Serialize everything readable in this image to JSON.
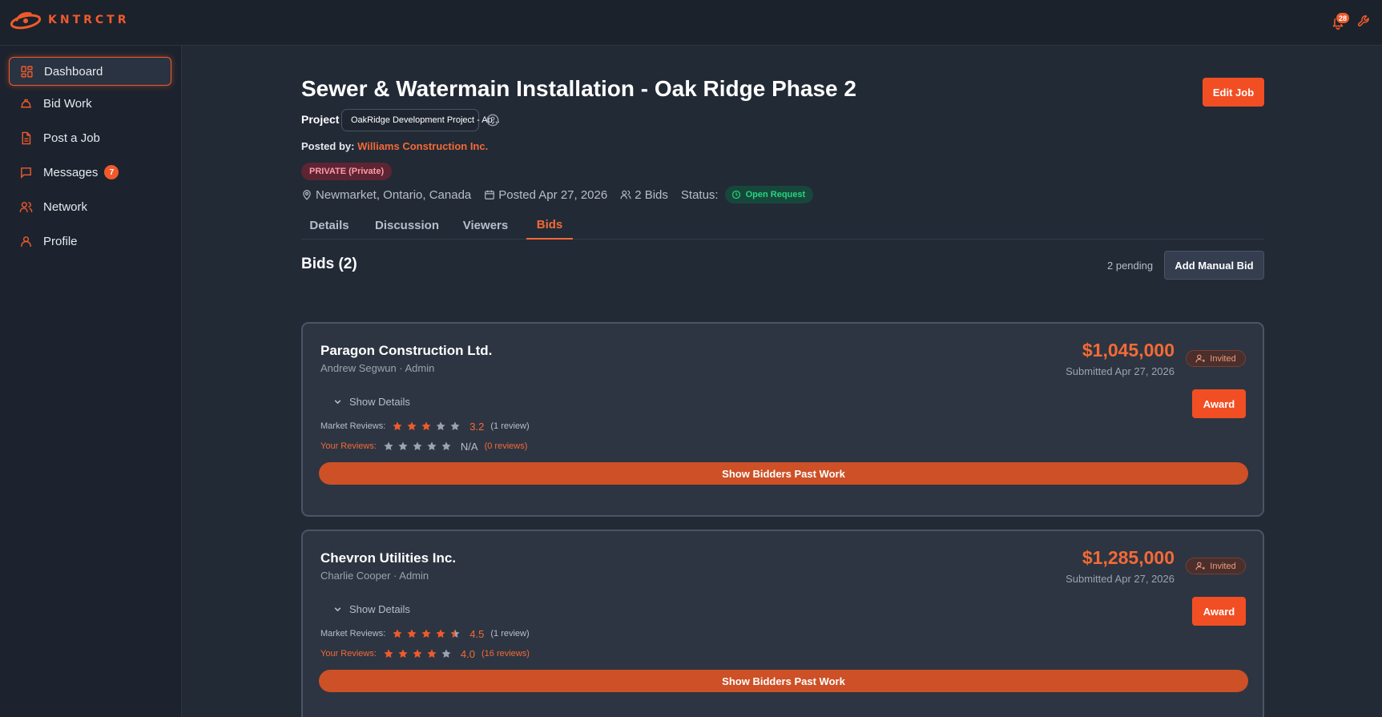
{
  "app": {
    "logo_text": "KNTRCTR",
    "notification_count": "28",
    "accent": "#f05a2b"
  },
  "sidebar": {
    "items": [
      {
        "label": "Dashboard",
        "icon": "dashboard-icon"
      },
      {
        "label": "Bid Work",
        "icon": "hardhat-icon"
      },
      {
        "label": "Post a Job",
        "icon": "document-icon"
      },
      {
        "label": "Messages",
        "icon": "message-icon",
        "badge": "7"
      },
      {
        "label": "Network",
        "icon": "users-icon"
      },
      {
        "label": "Profile",
        "icon": "user-icon"
      }
    ]
  },
  "job": {
    "title": "Sewer & Watermain Installation - Oak Ridge Phase 2",
    "edit_label": "Edit Job",
    "project_label": "Project",
    "project_value": "OakRidge Development Project - Ap...",
    "posted_by_label": "Posted by:",
    "posted_by_company": "Williams Construction Inc.",
    "privacy_badge": "PRIVATE (Private)",
    "location": "Newmarket, Ontario, Canada",
    "posted_date": "Posted Apr 27, 2026",
    "bid_count": "2 Bids",
    "status_label": "Status:",
    "status_value": "Open Request"
  },
  "tabs": [
    {
      "label": "Details"
    },
    {
      "label": "Discussion"
    },
    {
      "label": "Viewers"
    },
    {
      "label": "Bids",
      "active": true
    }
  ],
  "bids_section": {
    "heading": "Bids (2)",
    "pending": "2 pending",
    "add_manual_label": "Add Manual Bid"
  },
  "bids": [
    {
      "company": "Paragon Construction Ltd.",
      "contact": "Andrew Segwun · Admin",
      "amount": "$1,045,000",
      "submitted": "Submitted Apr 27, 2026",
      "badge": "Invited",
      "show_details": "Show Details",
      "award_label": "Award",
      "market_label": "Market Reviews:",
      "market_rating": 3.2,
      "market_score": "3.2",
      "market_count": "(1 review)",
      "your_label": "Your Reviews:",
      "your_rating": 0,
      "your_score": "N/A",
      "your_count": "(0 reviews)",
      "past_work_label": "Show Bidders Past Work"
    },
    {
      "company": "Chevron Utilities Inc.",
      "contact": "Charlie Cooper · Admin",
      "amount": "$1,285,000",
      "submitted": "Submitted Apr 27, 2026",
      "badge": "Invited",
      "show_details": "Show Details",
      "award_label": "Award",
      "market_label": "Market Reviews:",
      "market_rating": 4.5,
      "market_score": "4.5",
      "market_count": "(1 review)",
      "your_label": "Your Reviews:",
      "your_rating": 4.0,
      "your_score": "4.0",
      "your_count": "(16 reviews)",
      "past_work_label": "Show Bidders Past Work"
    }
  ]
}
